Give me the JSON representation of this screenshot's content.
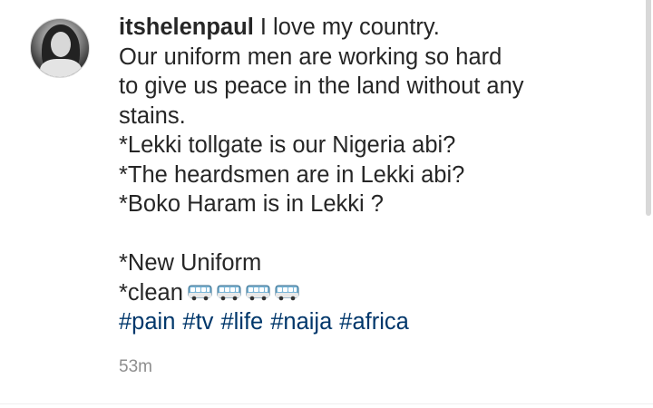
{
  "post": {
    "username": "itshelenpaul",
    "caption_lines": [
      "I love my country.",
      "Our uniform men are working so hard",
      "to give us peace in the land without any",
      "stains.",
      "*Lekki tollgate is our Nigeria abi?",
      "*The heardsmen are in Lekki abi?",
      "*Boko Haram is in Lekki ?",
      "",
      "*New Uniform",
      "*clean"
    ],
    "clean_emoji": [
      "bus-icon",
      "bus-icon",
      "bus-icon",
      "bus-icon"
    ],
    "hashtags": [
      "#pain",
      "#tv",
      "#life",
      "#naija",
      "#africa"
    ],
    "timestamp": "53m"
  },
  "colors": {
    "text": "#262626",
    "hashtag": "#00376b",
    "timestamp": "#8e8e8e"
  }
}
